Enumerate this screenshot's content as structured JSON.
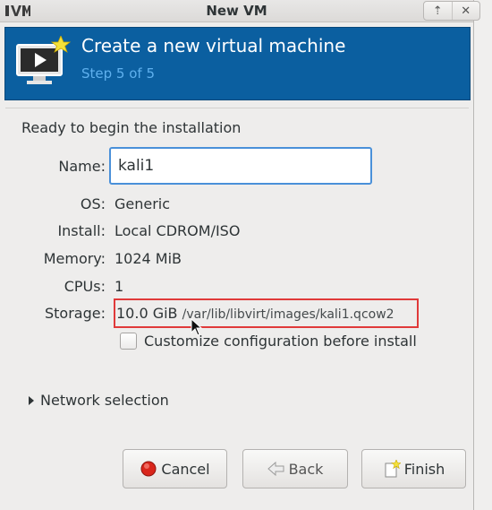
{
  "window": {
    "title": "New VM",
    "controls": {
      "restore_glyph": "⇡",
      "close_glyph": "✕"
    }
  },
  "banner": {
    "title": "Create a new virtual machine",
    "step": "Step 5 of 5",
    "icon": "monitor-play-star-icon",
    "background": "#0b5fa0"
  },
  "summary": {
    "heading": "Ready to begin the installation",
    "name_label": "Name:",
    "name_value": "kali1",
    "os_label": "OS:",
    "os_value": "Generic",
    "install_label": "Install:",
    "install_value": "Local CDROM/ISO",
    "memory_label": "Memory:",
    "memory_value": "1024 MiB",
    "cpus_label": "CPUs:",
    "cpus_value": "1",
    "storage_label": "Storage:",
    "storage_size": "10.0 GiB",
    "storage_path": "/var/lib/libvirt/images/kali1.qcow2",
    "highlight_color": "#e03a3a"
  },
  "options": {
    "customize_label": "Customize configuration before install",
    "customize_checked": false,
    "network_expander_label": "Network selection"
  },
  "buttons": {
    "cancel": "Cancel",
    "back": "Back",
    "finish": "Finish"
  }
}
